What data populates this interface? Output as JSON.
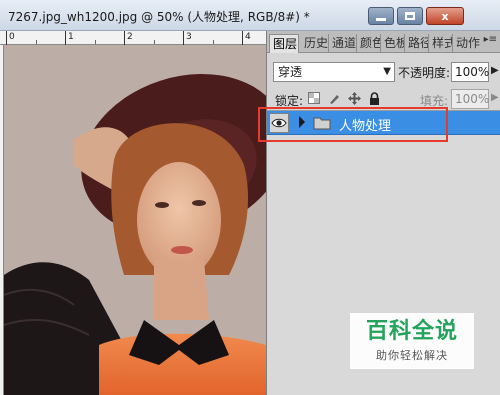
{
  "document": {
    "title": "7267.jpg_wh1200.jpg @ 50% (人物处理, RGB/8#) *",
    "ruler_marks": [
      "0",
      "1",
      "2",
      "3",
      "4"
    ]
  },
  "window_controls": {
    "minimize_icon": "minimize-icon",
    "maximize_icon": "maximize-icon",
    "close_glyph": "x"
  },
  "panel": {
    "tabs": [
      {
        "label": "图层",
        "active": true
      },
      {
        "label": "历史",
        "active": false
      },
      {
        "label": "通道",
        "active": false
      },
      {
        "label": "颜色",
        "active": false
      },
      {
        "label": "色板",
        "active": false
      },
      {
        "label": "路径",
        "active": false
      },
      {
        "label": "样式",
        "active": false
      },
      {
        "label": "动作",
        "active": false
      }
    ],
    "menu_glyph": "▸≡",
    "blend_mode": "穿透",
    "opacity_label": "不透明度:",
    "opacity_value": "100%",
    "lock_label": "锁定:",
    "fill_label": "填充:",
    "fill_value": "100%",
    "layers": [
      {
        "name": "人物处理",
        "type": "group",
        "visible": true,
        "selected": true
      }
    ]
  },
  "watermark": {
    "main": "百科全说",
    "sub": "助你轻松解决"
  },
  "colors": {
    "selection_blue": "#3a8fe4",
    "highlight_red": "#e53a2e",
    "watermark_green": "#23a35b"
  }
}
